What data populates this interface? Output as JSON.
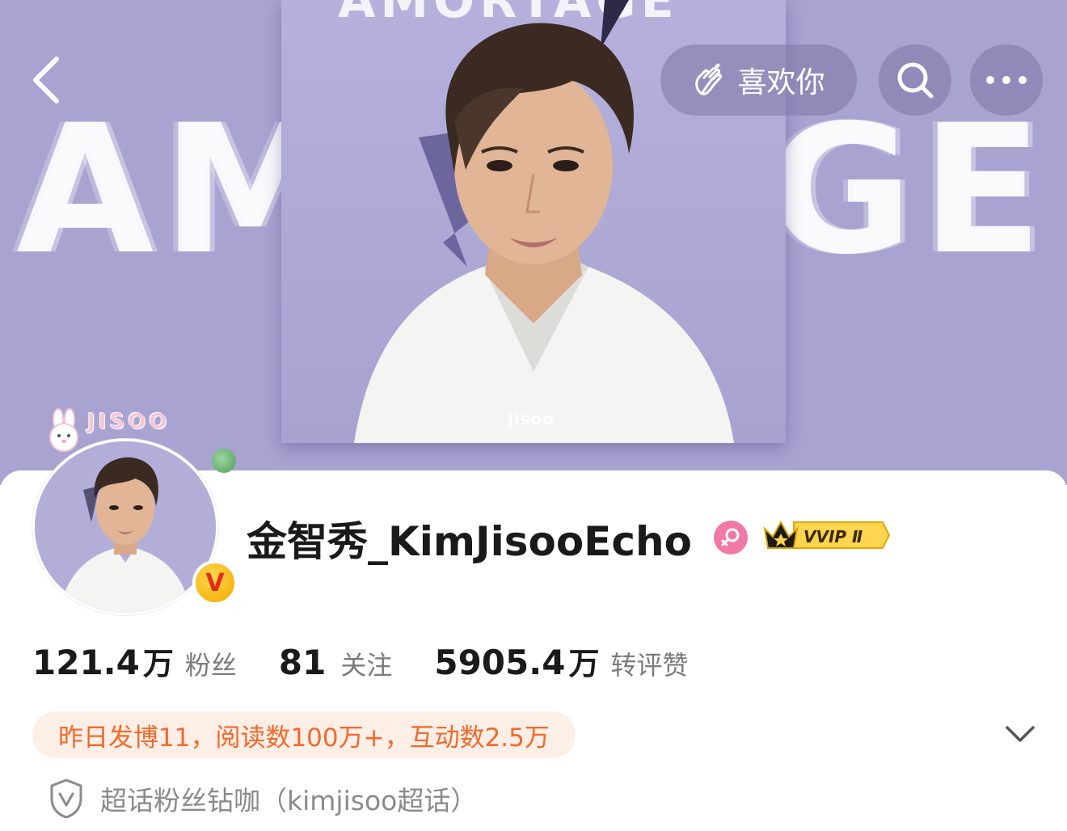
{
  "banner": {
    "background_text_left": "AM",
    "background_text_right": "AGE",
    "cover_top_text": "AMORTAGE",
    "cover_watermark": "jisoo"
  },
  "topbar": {
    "back_icon": "chevron-left-icon",
    "like_label": "喜欢你",
    "like_icon": "love-hand-icon",
    "search_icon": "search-icon",
    "more_icon": "more-dots-icon"
  },
  "profile": {
    "avatar_frame_text": "JISOO",
    "username": "金智秀_KimJisooEcho",
    "gender_icon": "female-icon",
    "vip_label": "VVIP Ⅱ",
    "verified_label": "V"
  },
  "stats": [
    {
      "num": "121.4",
      "unit": "万",
      "label": "粉丝"
    },
    {
      "num": "81",
      "unit": "",
      "label": "关注"
    },
    {
      "num": "5905.4",
      "unit": "万",
      "label": "转评赞"
    }
  ],
  "activity": {
    "text": "昨日发博11，阅读数100万+，互动数2.5万",
    "expand_icon": "chevron-down-icon"
  },
  "supertopic": {
    "icon": "shield-v-icon",
    "text": "超话粉丝钻咖（kimjisoo超话）"
  },
  "colors": {
    "banner_bg": "#a9a3d1",
    "activity_text": "#f06a2a",
    "activity_bg": "#fdeee6",
    "gender": "#f179a7",
    "verified": "#f2a800"
  }
}
